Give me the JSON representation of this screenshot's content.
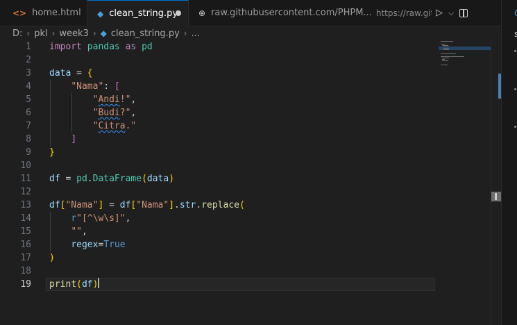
{
  "tabs": [
    {
      "label": "home.html",
      "icon": "html-file-icon"
    },
    {
      "label": "clean_string.py",
      "icon": "python-file-icon",
      "active": true,
      "modified": true
    },
    {
      "label": "raw.githubusercontent.com/PHPM...",
      "description": "https://raw.githubus",
      "icon": "globe-icon"
    }
  ],
  "tab_actions": {
    "run_symbol": "▷",
    "dropdown_symbol": "⌵"
  },
  "breadcrumb": [
    "D:",
    "pkl",
    "week3",
    "clean_string.py",
    "..."
  ],
  "breadcrumb_sep": "›",
  "editor": {
    "line_numbers": [
      "1",
      "2",
      "3",
      "4",
      "5",
      "6",
      "7",
      "8",
      "9",
      "10",
      "11",
      "12",
      "13",
      "14",
      "15",
      "16",
      "17",
      "18",
      "19"
    ],
    "active_line": 19
  },
  "side_pane": {
    "glyph": "C",
    "letter": "s"
  },
  "colors": {
    "accent": "#0078d4",
    "keyword": "#c586c0",
    "string": "#ce9178",
    "class": "#4ec9b0",
    "function": "#dcdcaa",
    "constant": "#569cd6",
    "variable": "#9cdcfe"
  }
}
